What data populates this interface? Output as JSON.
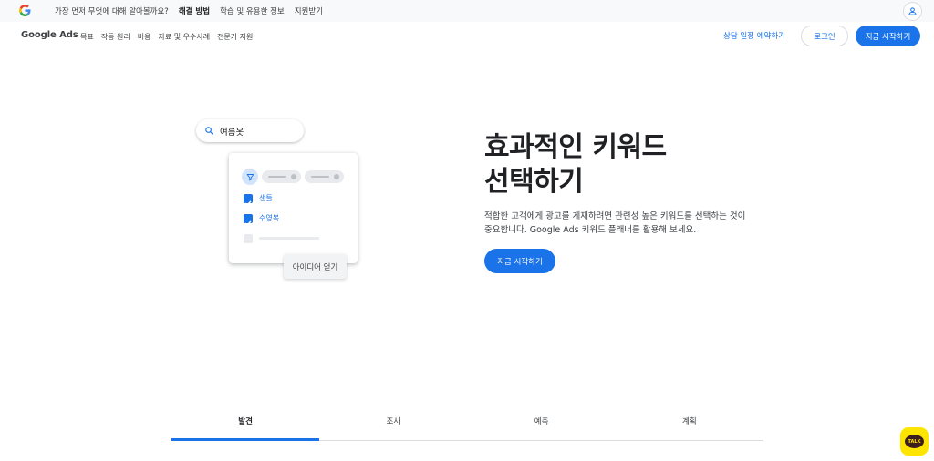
{
  "topbar": {
    "logo_icon": "google-g-logo",
    "nav": [
      {
        "label": "가장 먼저 무엇에 대해 알아볼까요?",
        "active": false
      },
      {
        "label": "해결 방법",
        "active": true
      },
      {
        "label": "학습 및 유용한 정보",
        "active": false
      },
      {
        "label": "지원받기",
        "active": false
      }
    ],
    "account_icon": "person-icon"
  },
  "header": {
    "brand": "Google Ads",
    "nav": [
      "목표",
      "작동 원리",
      "비용",
      "자료 및 우수사례",
      "전문가 지원"
    ],
    "consult_link": "상담 일정 예약하기",
    "login_label": "로그인",
    "start_label": "지금 시작하기"
  },
  "illustration": {
    "search_icon": "search-icon",
    "search_text": "여름옷",
    "filter_icon": "filter-icon",
    "options": [
      {
        "label": "샌들",
        "checked": true
      },
      {
        "label": "수영복",
        "checked": true
      }
    ],
    "ideas_label": "아이디어 얻기"
  },
  "hero": {
    "title_line1": "효과적인 키워드",
    "title_line2": "선택하기",
    "desc_line1": "적합한 고객에게 광고를 게재하려면 관련성 높은 키워드를 선택하는 것이",
    "desc_line2": "중요합니다. Google Ads 키워드 플래너를 활용해 보세요.",
    "cta_label": "지금 시작하기"
  },
  "tabs": [
    {
      "label": "발견",
      "active": true
    },
    {
      "label": "조사",
      "active": false
    },
    {
      "label": "예측",
      "active": false
    },
    {
      "label": "계획",
      "active": false
    }
  ],
  "kakao": {
    "label": "TALK",
    "icon": "kakao-talk-icon"
  },
  "colors": {
    "accent": "#1a73e8",
    "kakao": "#fee500"
  }
}
